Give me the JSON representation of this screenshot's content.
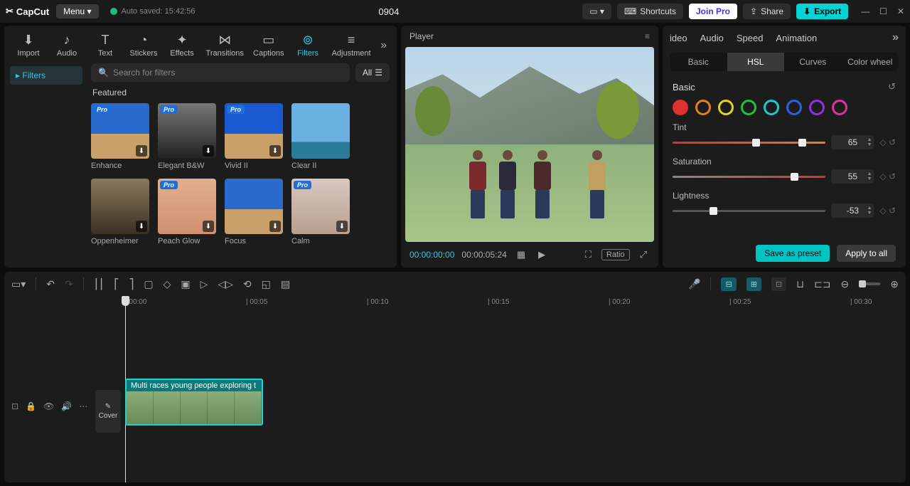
{
  "titlebar": {
    "app": "CapCut",
    "menu": "Menu",
    "autosave": "Auto saved: 15:42:56",
    "project": "0904",
    "shortcuts": "Shortcuts",
    "join": "Join Pro",
    "share": "Share",
    "export": "Export"
  },
  "topTabs": [
    "Import",
    "Audio",
    "Text",
    "Stickers",
    "Effects",
    "Transitions",
    "Captions",
    "Filters",
    "Adjustment"
  ],
  "topTabsActive": 7,
  "sidebar": {
    "item": "Filters"
  },
  "search": {
    "placeholder": "Search for filters",
    "all": "All"
  },
  "featured": {
    "title": "Featured",
    "items": [
      {
        "label": "Enhance",
        "pro": true,
        "dl": true,
        "bg": "linear-gradient(#2a6acc 55%,#c9a06a 55%)"
      },
      {
        "label": "Elegant B&W",
        "pro": true,
        "dl": true,
        "bg": "linear-gradient(#777 0%,#222 100%)"
      },
      {
        "label": "Vivid II",
        "pro": true,
        "dl": true,
        "bg": "linear-gradient(#1a5ad0 55%,#c9a06a 55%)"
      },
      {
        "label": "Clear II",
        "pro": false,
        "dl": false,
        "bg": "linear-gradient(#6ab0e0 70%,#2a7a9a 70%)"
      },
      {
        "label": "Oppenheimer",
        "pro": false,
        "dl": true,
        "bg": "linear-gradient(#8a7a5a,#3a3024)"
      },
      {
        "label": "Peach Glow",
        "pro": true,
        "dl": true,
        "bg": "linear-gradient(#e0b090,#d09070)"
      },
      {
        "label": "Focus",
        "pro": false,
        "dl": true,
        "bg": "linear-gradient(#2a6acc 55%,#c9a06a 55%)"
      },
      {
        "label": "Calm",
        "pro": true,
        "dl": true,
        "bg": "linear-gradient(#d8c8c0,#b8a090)"
      }
    ]
  },
  "player": {
    "title": "Player",
    "current": "00:00:00:00",
    "duration": "00:00:05:24",
    "ratio": "Ratio"
  },
  "rightTabs": [
    "ideo",
    "Audio",
    "Speed",
    "Animation"
  ],
  "subTabs": [
    "Basic",
    "HSL",
    "Curves",
    "Color wheel"
  ],
  "subTabActive": 1,
  "basicLabel": "Basic",
  "hslColors": [
    "#e03030",
    "#e08020",
    "#e8d020",
    "#20c040",
    "#20c8c8",
    "#3060e0",
    "#9030e0",
    "#e030a0"
  ],
  "hslSelected": 0,
  "sliders": {
    "tint": {
      "label": "Tint",
      "value": "65",
      "pos": 82
    },
    "saturation": {
      "label": "Saturation",
      "value": "55",
      "pos": 77
    },
    "lightness": {
      "label": "Lightness",
      "value": "-53",
      "pos": 24
    }
  },
  "actions": {
    "preset": "Save as preset",
    "apply": "Apply to all"
  },
  "ruler": [
    "00:00",
    "00:05",
    "00:10",
    "00:15",
    "00:20",
    "00:25",
    "00:30"
  ],
  "clip": {
    "label": "Multi races young people exploring t",
    "cover": "Cover"
  }
}
